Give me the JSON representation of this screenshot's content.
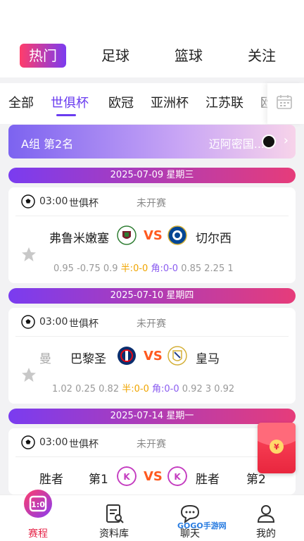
{
  "main_tabs": [
    "热门",
    "足球",
    "篮球",
    "关注"
  ],
  "sub_tabs": [
    "全部",
    "世俱杯",
    "欧冠",
    "亚洲杯",
    "江苏联",
    "欧"
  ],
  "group_bar": {
    "left": "A组 第2名",
    "right": "迈阿密国..."
  },
  "sections": [
    {
      "date": "2025-07-09 星期三",
      "time": "03:00",
      "league": "世俱杯",
      "status": "未开赛",
      "home": "弗鲁米嫩塞",
      "away": "切尔西",
      "odds_left": "0.95 -0.75 0.9",
      "half_label": "半:",
      "half_val": "0-0",
      "corner_label": "角:",
      "corner_val": "0-0",
      "odds_right": "0.85 2.25 1"
    },
    {
      "date": "2025-07-10 星期四",
      "time": "03:00",
      "league": "世俱杯",
      "status": "未开赛",
      "home_pre": "曼",
      "home": "巴黎圣",
      "away": "皇马",
      "odds_left": "1.02 0.25 0.82",
      "half_label": "半:",
      "half_val": "0-0",
      "corner_label": "角:",
      "corner_val": "0-0",
      "odds_right": "0.92 3 0.92"
    },
    {
      "date": "2025-07-14 星期一",
      "time": "03:00",
      "league": "世俱杯",
      "status": "未开赛",
      "home_pre": "胜者",
      "home": "第1",
      "away_pre": "胜者",
      "away": "第2"
    }
  ],
  "vs_label": "VS",
  "bottom_nav": [
    "赛程",
    "资料库",
    "聊天",
    "我的"
  ],
  "watermark": "GOGO手游网",
  "colors": {
    "accent_purple": "#6a3cf0",
    "accent_red": "#e6264a",
    "vs_orange": "#ff5a1f",
    "half_yellow": "#f0a500"
  }
}
